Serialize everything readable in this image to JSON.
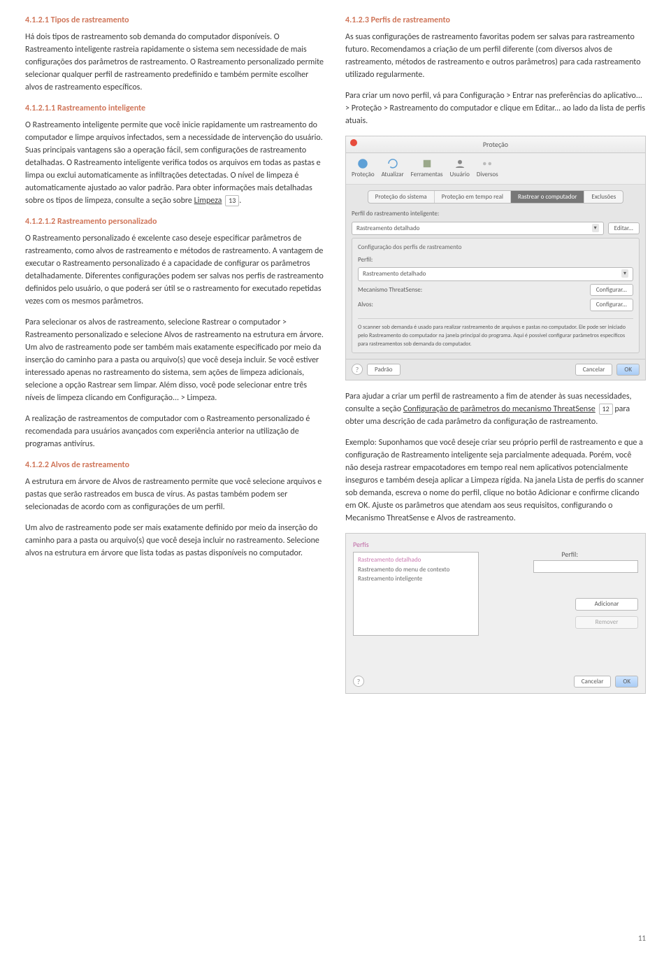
{
  "pageNumber": "11",
  "left": {
    "h1": "4.1.2.1  Tipos de rastreamento",
    "p1": "Há dois tipos de rastreamento sob demanda do computador disponíveis. O Rastreamento inteligente rastreia rapidamente o sistema sem necessidade de mais configurações dos parâmetros de rastreamento. O Rastreamento personalizado permite selecionar qualquer perfil de rastreamento predefinido e também permite escolher alvos de rastreamento específicos.",
    "h2": "4.1.2.1.1  Rastreamento inteligente",
    "p2a": "O Rastreamento inteligente permite que você inicie rapidamente um rastreamento do computador e limpe arquivos infectados, sem a necessidade de intervenção do usuário. Suas principais vantagens são a operação fácil, sem configurações de rastreamento detalhadas. O Rastreamento inteligente verifica todos os arquivos em todas as pastas e limpa ou exclui automaticamente as infiltrações detectadas. O nível de limpeza é automaticamente ajustado ao valor padrão. Para obter informações mais detalhadas sobre os tipos de limpeza, consulte a seção sobre ",
    "p2link": "Limpeza",
    "p2ref": "13",
    "h3": "4.1.2.1.2  Rastreamento personalizado",
    "p3": "O Rastreamento personalizado é excelente caso deseje especificar parâmetros de rastreamento, como alvos de rastreamento e métodos de rastreamento. A vantagem de executar o Rastreamento personalizado é a capacidade de configurar os parâmetros detalhadamente. Diferentes configurações podem ser salvas nos perfis de rastreamento definidos pelo usuário, o que poderá ser útil se o rastreamento for executado repetidas vezes com os mesmos parâmetros.",
    "p4": "Para selecionar os alvos de rastreamento, selecione Rastrear o computador > Rastreamento personalizado e selecione Alvos de rastreamento na estrutura em árvore. Um alvo de rastreamento pode ser também mais exatamente especificado por meio da inserção do caminho para a pasta ou arquivo(s) que você deseja incluir. Se você estiver interessado apenas no rastreamento do sistema, sem ações de limpeza adicionais, selecione a opção Rastrear sem limpar. Além disso, você pode selecionar entre três níveis de limpeza clicando em Configuração... > Limpeza.",
    "p5": "A realização de rastreamentos de computador com o Rastreamento personalizado é recomendada para usuários avançados com experiência anterior na utilização de programas antivírus.",
    "h4": "4.1.2.2  Alvos de rastreamento",
    "p6": "A estrutura em árvore de Alvos de rastreamento permite que você selecione arquivos e pastas que serão rastreados em busca de vírus. As pastas também podem ser selecionadas de acordo com as configurações de um perfil.",
    "p7": "Um alvo de rastreamento pode ser mais exatamente definido por meio da inserção do caminho para a pasta ou arquivo(s) que você deseja incluir no rastreamento. Selecione alvos na estrutura em árvore que lista todas as pastas disponíveis no computador."
  },
  "right": {
    "h1": "4.1.2.3  Perfis de rastreamento",
    "p1": "As suas configurações de rastreamento favoritas podem ser salvas para rastreamento futuro. Recomendamos a criação de um perfil diferente (com diversos alvos de rastreamento, métodos de rastreamento e outros parâmetros) para cada rastreamento utilizado regularmente.",
    "p2a": "Para criar um novo perfil, vá para Configuração > Entrar nas preferências do aplicativo... > Proteção > Rastreamento do computador e clique em Editar... ao lado da lista de perfis atuais.",
    "p3a": "Para ajudar a criar um perfil de rastreamento a fim de atender às suas necessidades, consulte a seção ",
    "p3link": "Configuração de parâmetros do mecanismo ThreatSense",
    "p3ref": "12",
    "p3b": " para obter uma descrição de cada parâmetro da configuração de rastreamento.",
    "p4": "Exemplo: Suponhamos que você deseje criar seu próprio perfil de rastreamento e que a configuração de Rastreamento inteligente seja parcialmente adequada. Porém, você não deseja rastrear empacotadores em tempo real nem aplicativos potencialmente inseguros e também deseja aplicar a Limpeza rígida. Na janela Lista de perfis do scanner sob demanda, escreva o nome do perfil, clique no botão Adicionar e confirme clicando em OK. Ajuste os parâmetros que atendam aos seus requisitos, configurando o Mecanismo ThreatSense e Alvos de rastreamento."
  },
  "shot1": {
    "title": "Proteção",
    "toolbar": [
      "Proteção",
      "Atualizar",
      "Ferramentas",
      "Usuário",
      "Diversos"
    ],
    "tabs": [
      "Proteção do sistema",
      "Proteção em tempo real",
      "Rastrear o computador",
      "Exclusões"
    ],
    "labelPerf": "Perfil do rastreamento inteligente:",
    "select1": "Rastreamento detalhado",
    "btnEdit": "Editar...",
    "frameLabel": "Configuração dos perfis de rastreamento",
    "labelPerfil": "Perfil:",
    "select2": "Rastreamento detalhado",
    "mecLabel": "Mecanismo ThreatSense:",
    "btnConf": "Configurar...",
    "alvosLabel": "Alvos:",
    "btnConf2": "Configurar...",
    "note": "O scanner sob demanda é usado para realizar rastreamento de arquivos e pastas no computador. Ele pode ser iniciado pelo Rastreamento do computador na janela principal do programa. Aqui é possível configurar parâmetros específicos para rastreamentos sob demanda do computador.",
    "btnPadrao": "Padrão",
    "btnCancelar": "Cancelar",
    "btnOK": "OK"
  },
  "shot2": {
    "perfis": "Perfis",
    "items": [
      "Rastreamento detalhado",
      "Rastreamento do menu de contexto",
      "Rastreamento inteligente"
    ],
    "perfilLabel": "Perfil:",
    "btnAdd": "Adicionar",
    "btnRem": "Remover",
    "btnCancelar": "Cancelar",
    "btnOK": "OK"
  }
}
